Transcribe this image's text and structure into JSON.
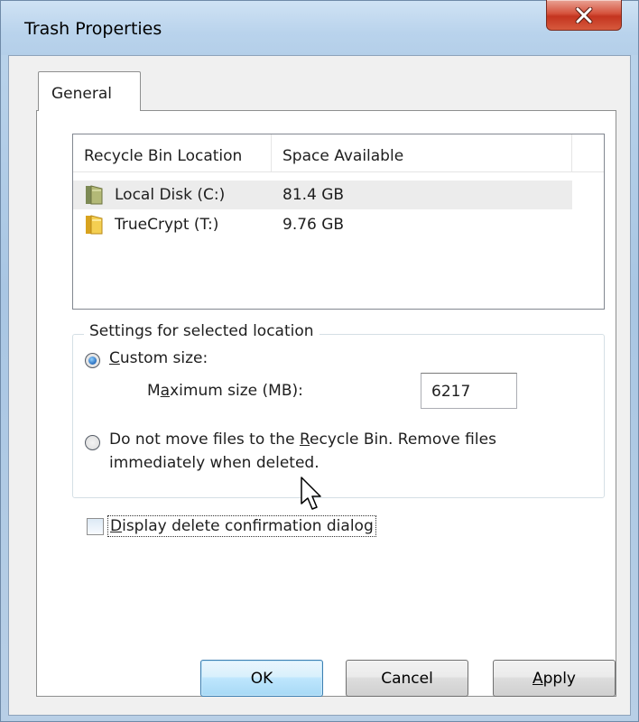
{
  "window": {
    "title": "Trash Properties",
    "close_label": "X"
  },
  "tabs": [
    {
      "label": "General",
      "selected": true
    }
  ],
  "listview": {
    "columns": [
      "Recycle Bin Location",
      "Space Available",
      ""
    ],
    "rows": [
      {
        "name": "Local Disk (C:)",
        "space": "81.4 GB",
        "icon": "drive-folder-icon",
        "selected": true
      },
      {
        "name": "TrueCrypt (T:)",
        "space": "9.76 GB",
        "icon": "folder-icon",
        "selected": false
      }
    ]
  },
  "settings": {
    "legend": "Settings for selected location",
    "custom_size": {
      "label_pre": "",
      "label_accel": "C",
      "label_post": "ustom size:",
      "checked": true
    },
    "max_size": {
      "label_pre": "M",
      "label_accel": "a",
      "label_post": "ximum size (MB):",
      "value": "6217"
    },
    "no_move": {
      "line1_pre": "Do not move files to the ",
      "line1_accel": "R",
      "line1_post": "ecycle Bin. Remove files",
      "line2": "immediately when deleted.",
      "checked": false
    }
  },
  "confirm": {
    "label_pre": "",
    "label_accel": "D",
    "label_post": "isplay delete confirmation dialog",
    "checked": false
  },
  "buttons": {
    "ok": "OK",
    "cancel": "Cancel",
    "apply_accel": "A",
    "apply_post": "pply"
  },
  "colors": {
    "frame": "#b9d3ec",
    "close": "#c4341f",
    "default_button": "#bee6fd",
    "selection": "#ececec"
  }
}
